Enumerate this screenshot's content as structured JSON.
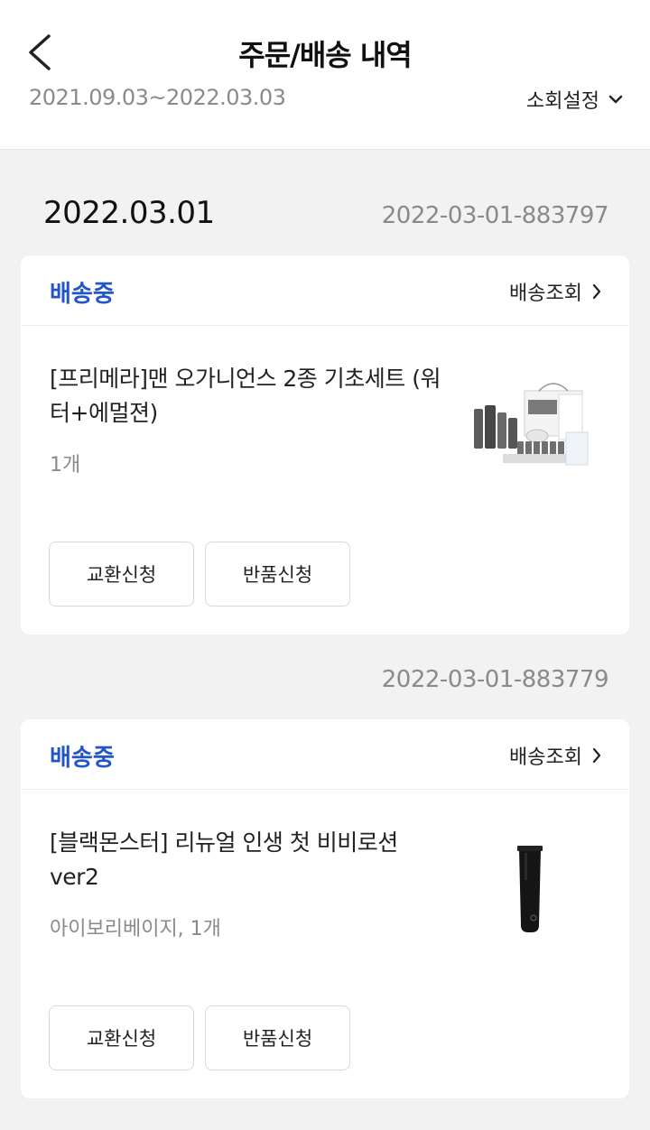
{
  "header": {
    "title": "주문/배송 내역",
    "date_range": "2021.09.03~2022.03.03",
    "filter_label": "소회설정"
  },
  "icons": {
    "back": "chevron-left-icon",
    "filter": "chevron-down-icon",
    "track": "chevron-right-icon"
  },
  "colors": {
    "status": "#2354c9",
    "background": "#f2f2f2"
  },
  "order_group": {
    "date": "2022.03.01"
  },
  "orders": [
    {
      "order_number": "2022-03-01-883797",
      "status": "배송중",
      "track_label": "배송조회",
      "product_name": "[프리메라]맨 오가니언스 2종 기초세트 (워터+에멀젼)",
      "option": "1개",
      "exchange_label": "교환신청",
      "refund_label": "반품신청"
    },
    {
      "order_number": "2022-03-01-883779",
      "status": "배송중",
      "track_label": "배송조회",
      "product_name": "[블랙몬스터] 리뉴얼 인생 첫 비비로션 ver2",
      "option": "아이보리베이지, 1개",
      "exchange_label": "교환신청",
      "refund_label": "반품신청"
    }
  ]
}
